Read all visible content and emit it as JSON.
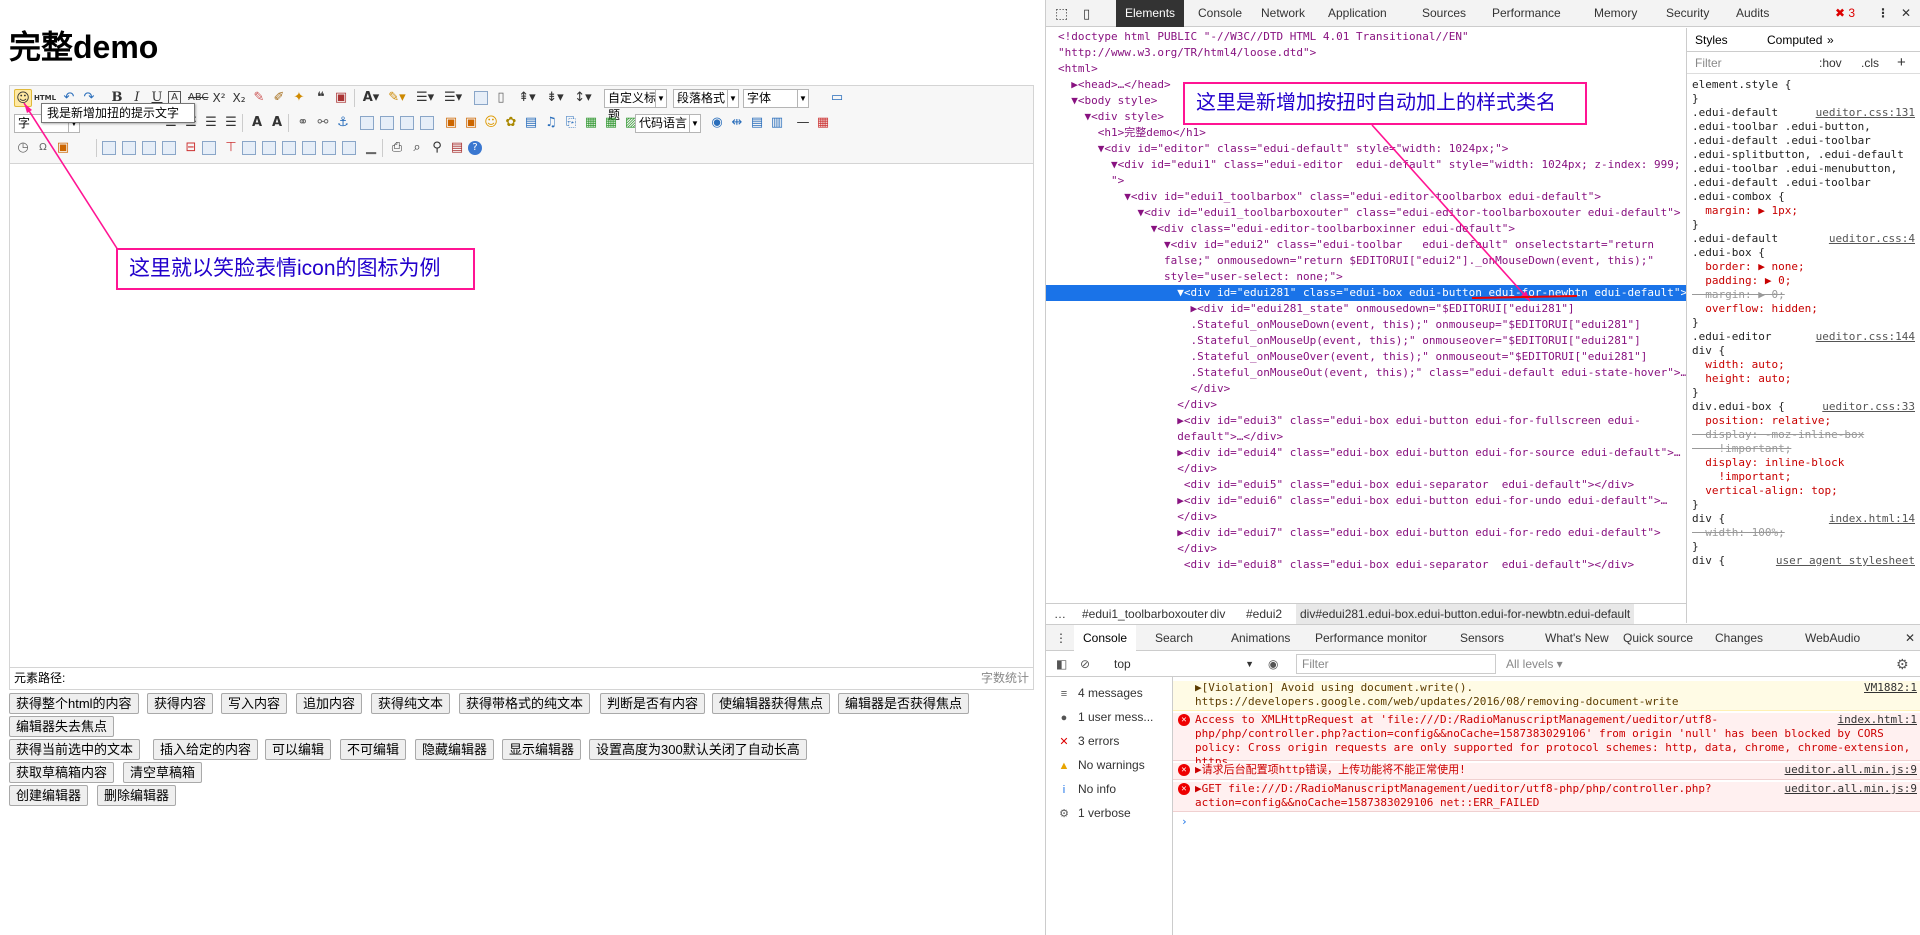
{
  "page": {
    "title": "完整demo"
  },
  "toolbar": {
    "tooltip": "我是新增加扭的提示文字",
    "row1": {
      "html_label": "HTML",
      "custom_title": "自定义标题",
      "paragraph": "段落格式",
      "font": "字体"
    },
    "row2": {
      "style_label": "字",
      "code_lang": "代码语言"
    }
  },
  "status": {
    "path_label": "元素路径:",
    "word_count": "字数统计"
  },
  "buttons": {
    "row1": [
      "获得整个html的内容",
      "获得内容",
      "写入内容",
      "追加内容",
      "获得纯文本",
      "获得带格式的纯文本",
      "判断是否有内容",
      "使编辑器获得焦点",
      "编辑器是否获得焦点"
    ],
    "row2": [
      "编辑器失去焦点"
    ],
    "row3": [
      "获得当前选中的文本",
      "插入给定的内容",
      "可以编辑",
      "不可编辑",
      "隐藏编辑器",
      "显示编辑器",
      "设置高度为300默认关闭了自动长高"
    ],
    "row4": [
      "获取草稿箱内容",
      "清空草稿箱"
    ],
    "row5": [
      "创建编辑器",
      "删除编辑器"
    ]
  },
  "annotations": {
    "left": "这里就以笑脸表情icon的图标为例",
    "right": "这里是新增加按扭时自动加上的样式类名",
    "color": "#ff1493"
  },
  "devtools": {
    "tabs": [
      "Elements",
      "Console",
      "Network",
      "Application",
      "Sources",
      "Performance",
      "Memory",
      "Security",
      "Audits"
    ],
    "error_count": "3",
    "elements": [
      "<!doctype html PUBLIC \"-//W3C//DTD HTML 4.01 Transitional//EN\"",
      "\"http://www.w3.org/TR/html4/loose.dtd\">",
      "<html>",
      "  ▶<head>…</head>",
      "  ▼<body style>",
      "    ▼<div style>",
      "      <h1>完整demo</h1>",
      "      ▼<div id=\"editor\" class=\"edui-default\" style=\"width: 1024px;\">",
      "        ▼<div id=\"edui1\" class=\"edui-editor  edui-default\" style=\"width: 1024px; z-index: 999;",
      "        \">",
      "          ▼<div id=\"edui1_toolbarbox\" class=\"edui-editor-toolbarbox edui-default\">",
      "            ▼<div id=\"edui1_toolbarboxouter\" class=\"edui-editor-toolbarboxouter edui-default\">",
      "              ▼<div class=\"edui-editor-toolbarboxinner edui-default\">",
      "                ▼<div id=\"edui2\" class=\"edui-toolbar   edui-default\" onselectstart=\"return",
      "                false;\" onmousedown=\"return $EDITORUI[\"edui2\"]._onMouseDown(event, this);\"",
      "                style=\"user-select: none;\">",
      "                  ▼<div id=\"edui281\" class=\"edui-box edui-button edui-for-newbtn edui-default\">",
      "                    ▶<div id=\"edui281_state\" onmousedown=\"$EDITORUI[\"edui281\"]",
      "                    .Stateful_onMouseDown(event, this);\" onmouseup=\"$EDITORUI[\"edui281\"]",
      "                    .Stateful_onMouseUp(event, this);\" onmouseover=\"$EDITORUI[\"edui281\"]",
      "                    .Stateful_onMouseOver(event, this);\" onmouseout=\"$EDITORUI[\"edui281\"]",
      "                    .Stateful_onMouseOut(event, this);\" class=\"edui-default edui-state-hover\">…",
      "                    </div>",
      "                  </div>",
      "                  ▶<div id=\"edui3\" class=\"edui-box edui-button edui-for-fullscreen edui-",
      "                  default\">…</div>",
      "                  ▶<div id=\"edui4\" class=\"edui-box edui-button edui-for-source edui-default\">…",
      "                  </div>",
      "                   <div id=\"edui5\" class=\"edui-box edui-separator  edui-default\"></div>",
      "                  ▶<div id=\"edui6\" class=\"edui-box edui-button edui-for-undo edui-default\">…",
      "                  </div>",
      "                  ▶<div id=\"edui7\" class=\"edui-box edui-button edui-for-redo edui-default\">",
      "                  </div>",
      "                   <div id=\"edui8\" class=\"edui-box edui-separator  edui-default\"></div>"
    ],
    "breadcrumb": [
      "…",
      "#edui1_toolbarboxouter",
      "div",
      "#edui2",
      "div#edui281.edui-box.edui-button.edui-for-newbtn.edui-default"
    ],
    "styles": {
      "tabs": [
        "Styles",
        "Computed"
      ],
      "filter_placeholder": "Filter",
      "hov": ":hov",
      "cls": ".cls",
      "lines": [
        {
          "t": "element.style {",
          "s": ""
        },
        {
          "t": "}",
          "s": ""
        },
        {
          "t": ".edui-default",
          "s": "ueditor.css:131"
        },
        {
          "t": ".edui-toolbar .edui-button,",
          "s": ""
        },
        {
          "t": ".edui-default .edui-toolbar",
          "s": ""
        },
        {
          "t": ".edui-splitbutton, .edui-default",
          "s": ""
        },
        {
          "t": ".edui-toolbar .edui-menubutton,",
          "s": ""
        },
        {
          "t": ".edui-default .edui-toolbar",
          "s": ""
        },
        {
          "t": ".edui-combox {",
          "s": ""
        },
        {
          "t": "  margin: ▶ 1px;",
          "s": "",
          "p": true
        },
        {
          "t": "}",
          "s": ""
        },
        {
          "t": ".edui-default",
          "s": "ueditor.css:4"
        },
        {
          "t": ".edui-box {",
          "s": ""
        },
        {
          "t": "  border: ▶ none;",
          "s": "",
          "p": true
        },
        {
          "t": "  padding: ▶ 0;",
          "s": "",
          "p": true
        },
        {
          "t": "  margin: ▶ 0;",
          "s": "",
          "p": true,
          "x": true
        },
        {
          "t": "  overflow: hidden;",
          "s": "",
          "p": true
        },
        {
          "t": "}",
          "s": ""
        },
        {
          "t": ".edui-editor",
          "s": "ueditor.css:144"
        },
        {
          "t": "div {",
          "s": ""
        },
        {
          "t": "  width: auto;",
          "s": "",
          "p": true
        },
        {
          "t": "  height: auto;",
          "s": "",
          "p": true
        },
        {
          "t": "}",
          "s": ""
        },
        {
          "t": "div.edui-box {",
          "s": "ueditor.css:33"
        },
        {
          "t": "  position: relative;",
          "s": "",
          "p": true
        },
        {
          "t": "  display: -moz-inline-box",
          "s": "",
          "p": true,
          "x": true
        },
        {
          "t": "    !important;",
          "s": "",
          "p": true,
          "x": true
        },
        {
          "t": "  display: inline-block",
          "s": "",
          "p": true
        },
        {
          "t": "    !important;",
          "s": "",
          "p": true
        },
        {
          "t": "  vertical-align: top;",
          "s": "",
          "p": true
        },
        {
          "t": "}",
          "s": ""
        },
        {
          "t": "div {",
          "s": "index.html:14"
        },
        {
          "t": "  width: 100%;",
          "s": "",
          "p": true,
          "x": true
        },
        {
          "t": "}",
          "s": ""
        },
        {
          "t": "div {",
          "s": "user agent stylesheet"
        }
      ]
    },
    "console_tabs": [
      "Console",
      "Search",
      "Animations",
      "Performance monitor",
      "Sensors",
      "What's New",
      "Quick source",
      "Changes",
      "WebAudio"
    ],
    "console_bar": {
      "context": "top",
      "filter": "Filter",
      "levels": "All levels ▾"
    },
    "console_side": [
      {
        "icon": "≡",
        "label": "4 messages"
      },
      {
        "icon": "●",
        "label": "1 user mess..."
      },
      {
        "icon": "✕",
        "label": "3 errors"
      },
      {
        "icon": "▲",
        "label": "No warnings"
      },
      {
        "icon": "i",
        "label": "No info"
      },
      {
        "icon": "⚙",
        "label": "1 verbose"
      }
    ],
    "messages": [
      {
        "type": "warn",
        "text": "▶[Violation] Avoid using document.write(). https://developers.google.com/web/updates/2016/08/removing-document-write",
        "src": "VM1882:1"
      },
      {
        "type": "err",
        "text": "Access to XMLHttpRequest at 'file:///D:/RadioManuscriptManagement/ueditor/utf8-php/php/controller.php?action=config&&noCache=1587383029106' from origin 'null' has been blocked by CORS policy: Cross origin requests are only supported for protocol schemes: http, data, chrome, chrome-extension, https.",
        "src": "index.html:1"
      },
      {
        "type": "err",
        "text": "▶请求后台配置项http错误，上传功能将不能正常使用!",
        "src": "ueditor.all.min.js:9"
      },
      {
        "type": "err",
        "text": "▶GET file:///D:/RadioManuscriptManagement/ueditor/utf8-php/php/controller.php?action=config&&noCache=1587383029106 net::ERR_FAILED",
        "src": "ueditor.all.min.js:9"
      }
    ],
    "prompt": "›"
  }
}
